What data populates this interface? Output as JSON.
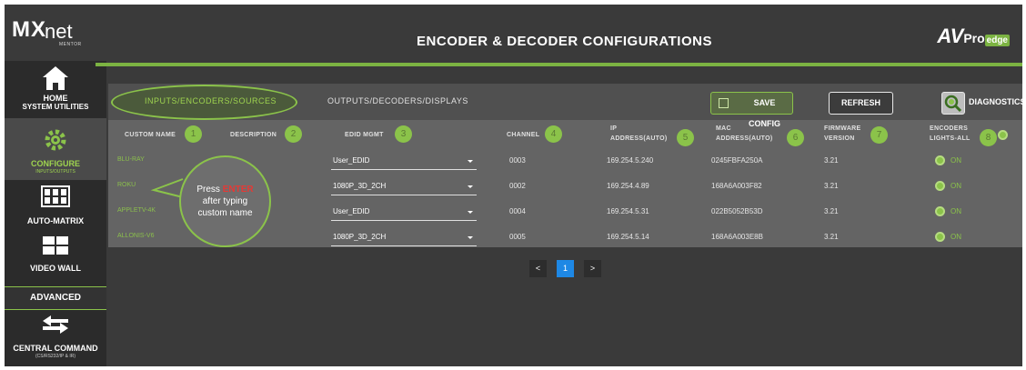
{
  "sidebar": {
    "logo_mx": "MX",
    "logo_net": "net",
    "logo_mentor": "MENTOR",
    "items": [
      {
        "label": "HOME",
        "sub_label": "SYSTEM UTILITIES"
      },
      {
        "label": "CONFIGURE",
        "sub_label": "INPUTS/OUTPUTS"
      },
      {
        "label": "AUTO-MATRIX",
        "sub_label": ""
      },
      {
        "label": "VIDEO WALL",
        "sub_label": ""
      }
    ],
    "advanced_label": "ADVANCED",
    "central": {
      "label": "CENTRAL COMMAND",
      "sub_label": "(CS/RS232/IP & IR)"
    }
  },
  "header": {
    "title": "ENCODER & DECODER CONFIGURATIONS",
    "brand_av": "AV",
    "brand_pro": "Pro",
    "brand_edge": "edge"
  },
  "tabs": {
    "inputs": "INPUTS/ENCODERS/SOURCES",
    "outputs": "OUTPUTS/DECODERS/DISPLAYS"
  },
  "toolbar": {
    "save_label": "SAVE CONFIG",
    "refresh_label": "REFRESH",
    "diagnostics_label": "DIAGNOSTICS"
  },
  "columns": {
    "custom_name": "CUSTOM NAME",
    "description": "DESCRIPTION",
    "edid_mgmt": "EDID MGMT",
    "channel": "CHANNEL",
    "ip_1": "IP",
    "ip_2": "ADDRESS(AUTO)",
    "mac_1": "MAC",
    "mac_2": "ADDRESS(AUTO)",
    "fw_1": "FIRMWARE",
    "fw_2": "VERSION",
    "enc_1": "ENCODERS",
    "enc_2": "LIGHTS-ALL"
  },
  "badges": [
    "1",
    "2",
    "3",
    "4",
    "5",
    "6",
    "7",
    "8"
  ],
  "rows": [
    {
      "name": "BLU-RAY",
      "edid": "User_EDID",
      "channel": "0003",
      "ip": "169.254.5.240",
      "mac": "0245FBFA250A",
      "firmware": "3.21",
      "light": "ON"
    },
    {
      "name": "ROKU",
      "edid": "1080P_3D_2CH",
      "channel": "0002",
      "ip": "169.254.4.89",
      "mac": "168A6A003F82",
      "firmware": "3.21",
      "light": "ON"
    },
    {
      "name": "APPLETV-4K",
      "edid": "User_EDID",
      "channel": "0004",
      "ip": "169.254.5.31",
      "mac": "022B5052B53D",
      "firmware": "3.21",
      "light": "ON"
    },
    {
      "name": "ALLONIS-V6",
      "edid": "1080P_3D_2CH",
      "channel": "0005",
      "ip": "169.254.5.14",
      "mac": "168A6A003E8B",
      "firmware": "3.21",
      "light": "ON"
    }
  ],
  "callout": {
    "line1_pre": "Press ",
    "line1_word": "ENTER",
    "line2": "after typing",
    "line3": "custom name"
  },
  "pagination": {
    "prev": "<",
    "current": "1",
    "next": ">"
  },
  "colors": {
    "accent": "#8bc34a",
    "page_active": "#1e88e5",
    "enter": "#e53935"
  }
}
